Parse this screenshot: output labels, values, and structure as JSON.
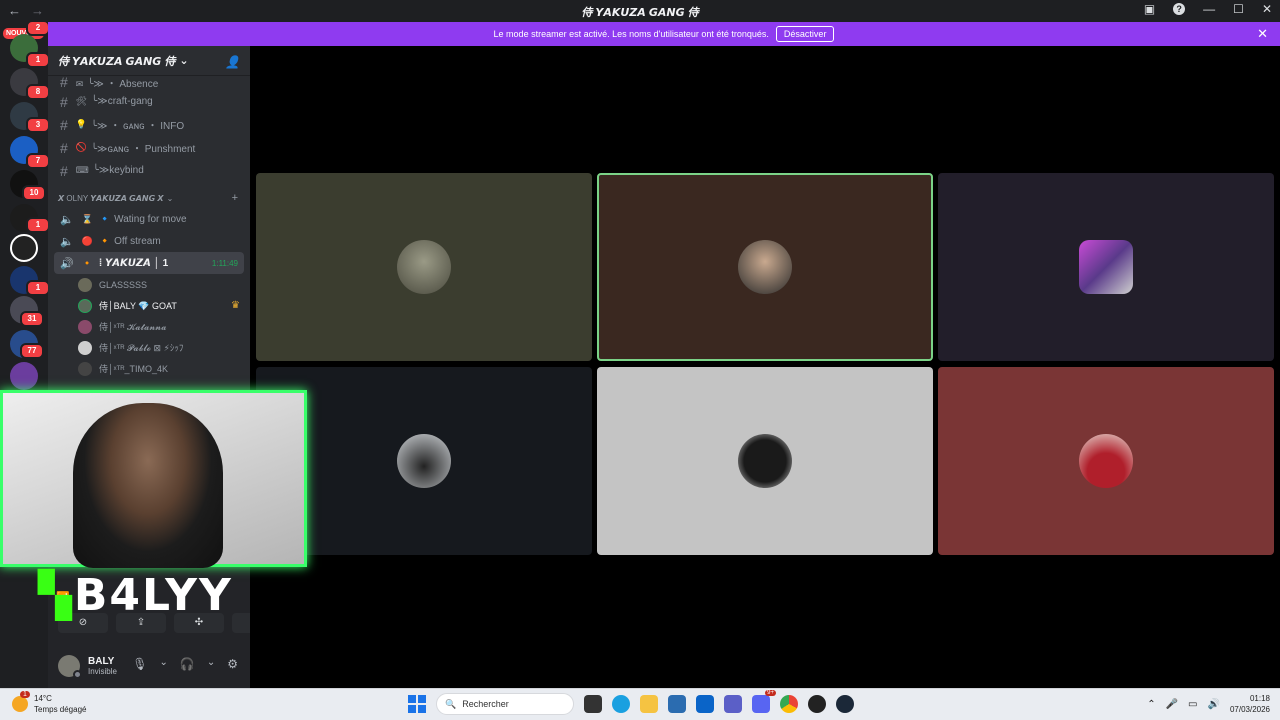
{
  "window": {
    "title": "侍 𝙔𝘼𝙆𝙐𝙕𝘼 𝙂𝘼𝙉𝙂 侍"
  },
  "guilds": {
    "nouveau": "NOUVEAU",
    "badges": [
      "2",
      "1",
      "8",
      "3",
      "7",
      "10",
      "1",
      "1",
      "31",
      "77"
    ]
  },
  "banner": {
    "text": "Le mode streamer est activé. Les noms d'utilisateur ont été tronqués.",
    "button": "Désactiver"
  },
  "server": {
    "name": "侍 𝙔𝘼𝙆𝙐𝙕𝘼 𝙂𝘼𝙉𝙂 侍",
    "channels": [
      {
        "emoji": "✉",
        "name": "╰≫ ・ Absence"
      },
      {
        "emoji": "🛠",
        "name": "╰≫craft-gang"
      },
      {
        "emoji": "💡",
        "name": "╰≫ ・ ɢᴀɴɢ ・ INFO"
      },
      {
        "emoji": "🚫",
        "name": "╰≫ɢᴀɴɢ ・ Punshment"
      },
      {
        "emoji": "⌨",
        "name": "╰≫keybind"
      }
    ],
    "category": "𝙓 OLNY 𝙔𝘼𝙆𝙐𝙕𝘼 𝙂𝘼𝙉𝙂 𝙓",
    "voice_channels": [
      {
        "emoji": "⌛",
        "name": "🔹 Wating for move"
      },
      {
        "emoji": "🔴",
        "name": "🔸 Off stream"
      },
      {
        "emoji": "🔸",
        "name": "⁞ 𝙔𝘼𝙆𝙐𝙕𝘼 │ 1",
        "time": "1:11:49"
      }
    ],
    "members": [
      {
        "name": "GLASSSSS",
        "crown": ""
      },
      {
        "name": "侍│BALY 💎 GOAT",
        "crown": "♛"
      },
      {
        "name": "侍│ˣᵀᴿ 𝓚𝓪𝓽𝓪𝓷𝓷𝓪",
        "crown": ""
      },
      {
        "name": "侍│ˣᵀᴿ 𝓟𝓪𝓫𝓵𝓸 ⊠ ⚡ｼｯﾌ",
        "crown": ""
      },
      {
        "name": "侍│ˣᵀᴿ_TIMO_4K",
        "crown": ""
      }
    ]
  },
  "overlay": {
    "logo": "B4LYY"
  },
  "user": {
    "name": "BALY",
    "status": "Invisible"
  },
  "taskbar": {
    "temp": "14°C",
    "weather": "Temps dégagé",
    "search_placeholder": "Rechercher",
    "time": "01:18",
    "date": "07/03/2026",
    "weather_badge": "1",
    "discord_badge": "9+"
  },
  "colors": {
    "accent": "#8f3bf0",
    "green": "#23a55a",
    "overlay_green": "#39ff14"
  }
}
